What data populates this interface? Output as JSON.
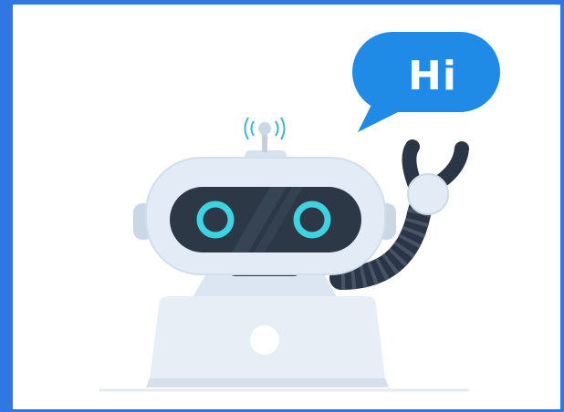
{
  "speech_bubble": {
    "text": "Hi"
  },
  "icons": {
    "robot": "chatbot-robot-illustration",
    "bubble": "speech-bubble",
    "laptop": "laptop",
    "signal": "wifi-signal-icon"
  },
  "colors": {
    "frame": "#2f78e4",
    "bubble": "#1f8be6",
    "robot_body": "#e3ecf6",
    "visor": "#2c3846",
    "eyes": "#3fd3e2",
    "arm": "#2a3545"
  }
}
